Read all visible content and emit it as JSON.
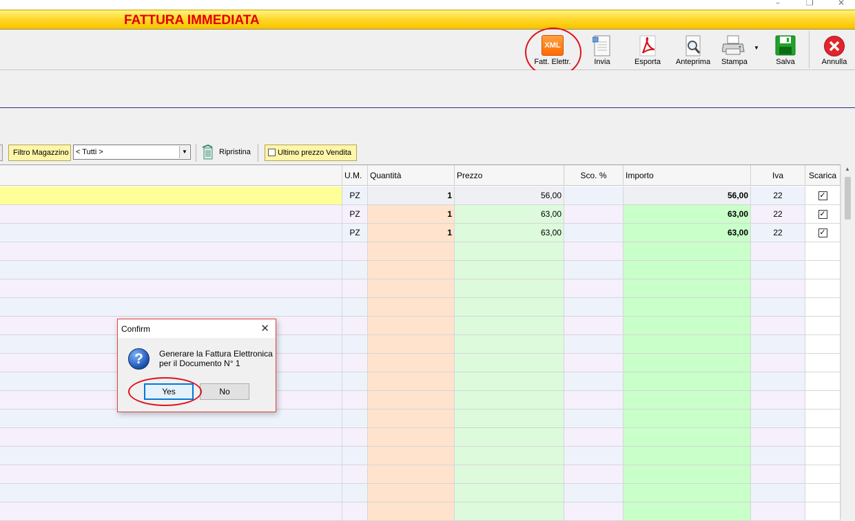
{
  "window": {
    "title": "FATTURA IMMEDIATA",
    "minimize_glyph": "–",
    "restore_glyph": "❐",
    "close_glyph": "✕"
  },
  "toolbar": {
    "items": [
      {
        "id": "fatt",
        "label": "Fatt. Elettr.",
        "icon": "xml-icon",
        "icon_text": "XML"
      },
      {
        "id": "invia",
        "label": "Invia",
        "icon": "send-document-icon"
      },
      {
        "id": "esporta",
        "label": "Esporta",
        "icon": "pdf-icon"
      },
      {
        "id": "anteprima",
        "label": "Anteprima",
        "icon": "magnifier-icon"
      },
      {
        "id": "stampa",
        "label": "Stampa",
        "icon": "printer-icon"
      },
      {
        "id": "salva",
        "label": "Salva",
        "icon": "floppy-icon"
      },
      {
        "id": "annulla",
        "label": "Annulla",
        "icon": "cancel-icon"
      }
    ]
  },
  "filter_bar": {
    "filtro_magazzino": "Filtro Magazzino",
    "magazzino_value": "< Tutti >",
    "ripristina": "Ripristina",
    "ultimo_prezzo": "Ultimo prezzo Vendita",
    "ultimo_prezzo_checked": false
  },
  "grid": {
    "columns": {
      "um": "U.M.",
      "quantita": "Quantità",
      "prezzo": "Prezzo",
      "sconto": "Sco. %",
      "importo": "Importo",
      "iva": "Iva",
      "scarica": "Scarica"
    },
    "rows": [
      {
        "um": "PZ",
        "quantita": "1",
        "prezzo": "56,00",
        "sconto": "",
        "importo": "56,00",
        "iva": "22",
        "scarica": true
      },
      {
        "um": "PZ",
        "quantita": "1",
        "prezzo": "63,00",
        "sconto": "",
        "importo": "63,00",
        "iva": "22",
        "scarica": true
      },
      {
        "um": "PZ",
        "quantita": "1",
        "prezzo": "63,00",
        "sconto": "",
        "importo": "63,00",
        "iva": "22",
        "scarica": true
      }
    ],
    "empty_rows": 15
  },
  "dialog": {
    "title": "Confirm",
    "message_line1": "Generare la Fattura Elettronica",
    "message_line2": "per il Documento N° 1",
    "yes": "Yes",
    "no": "No",
    "icon": "question-icon",
    "icon_glyph": "?"
  },
  "colors": {
    "header_title": "#e00000",
    "highlight_circle": "#e0101a",
    "row_selected": "#ffff99",
    "qty_column": "#ffe3cc",
    "price_column": "#ddfadd",
    "importo_column": "#c9ffc9",
    "row_alt_a": "#f5f0fc",
    "row_alt_b": "#eef3fb"
  }
}
